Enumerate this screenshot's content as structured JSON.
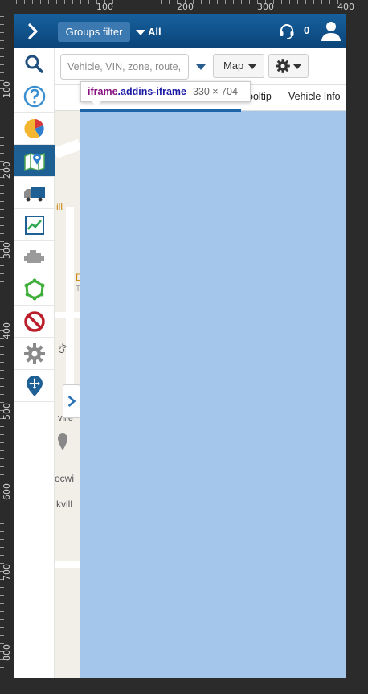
{
  "rulers": {
    "top": [
      "100",
      "200",
      "300",
      "400"
    ],
    "left": [
      "100",
      "200",
      "300",
      "400",
      "500",
      "600",
      "700",
      "800"
    ]
  },
  "header": {
    "menu_icon": "chevron-right-icon",
    "groups_filter_label": "Groups filter",
    "groups_all_label": "All",
    "support_icon": "headset-icon",
    "notification_count": "0",
    "user_icon": "user-icon",
    "bg_color": "#0b4478"
  },
  "nav": {
    "items": [
      {
        "icon": "search-icon"
      },
      {
        "icon": "help-icon"
      },
      {
        "icon": "pie-chart-icon"
      },
      {
        "icon": "map-icon",
        "active": true
      },
      {
        "icon": "truck-icon"
      },
      {
        "icon": "activity-chart-icon"
      },
      {
        "icon": "engine-icon"
      },
      {
        "icon": "zones-icon"
      },
      {
        "icon": "exceptions-icon"
      },
      {
        "icon": "settings-icon"
      },
      {
        "icon": "directions-icon"
      }
    ]
  },
  "toolbar": {
    "search_placeholder": "Vehicle, VIN, zone, route,",
    "map_label": "Map",
    "settings_icon": "gear-icon"
  },
  "tabs": {
    "tooltip_label": "ooltip",
    "vehicle_info_label": "Vehicle Info"
  },
  "map_labels": {
    "a": "ill",
    "b": "E",
    "c": "T",
    "d": "Cir",
    "e": "ville",
    "f": "ocwi",
    "g": "kvill"
  },
  "inspect_tooltip": {
    "tag": "iframe",
    "cls": ".addins-iframe",
    "dims": "330 × 704"
  },
  "colors": {
    "accent": "#1e5f94",
    "iframe_overlay": "#a3c6ea"
  }
}
